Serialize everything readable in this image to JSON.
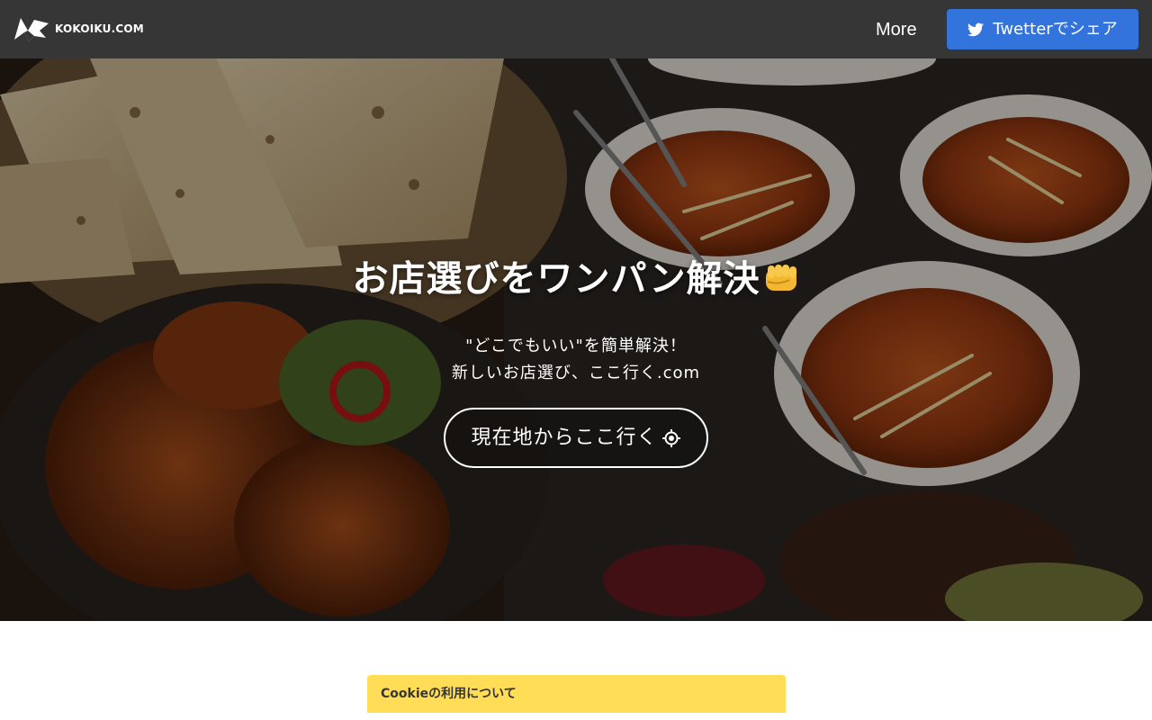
{
  "navbar": {
    "brand_text": "KOKOIKU.COM",
    "more_label": "More",
    "share_label": "Twetterでシェア",
    "background_color": "#363636",
    "share_color": "#3273dc"
  },
  "hero": {
    "title": "お店選びをワンパン解決",
    "title_emoji": "fist-icon",
    "subtitle_line1": "\"どこでもいい\"を簡単解決！",
    "subtitle_line2": "新しいお店選び、ここ行く.com",
    "locate_button_label": "現在地からここ行く",
    "background_description_icon": "food-photo"
  },
  "cookie_notice": {
    "title": "Cookieの利用について",
    "color": "#ffdd57"
  }
}
